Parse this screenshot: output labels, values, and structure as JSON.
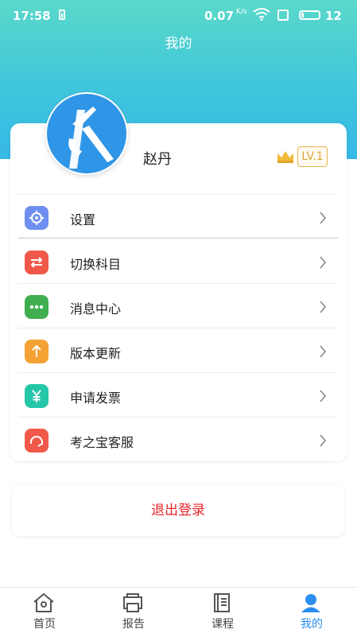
{
  "status_bar": {
    "time": "17:58",
    "speed": "0.07",
    "speed_unit": "K/s",
    "battery": "12"
  },
  "header": {
    "title": "我的"
  },
  "profile": {
    "name": "赵丹",
    "level": "LV.1"
  },
  "menu": {
    "items": [
      {
        "label": "设置",
        "icon": "gear-icon",
        "color": "#6f8ff0"
      },
      {
        "label": "切换科目",
        "icon": "swap-icon",
        "color": "#f0584a"
      },
      {
        "label": "消息中心",
        "icon": "message-icon",
        "color": "#3fae4f"
      },
      {
        "label": "版本更新",
        "icon": "upgrade-icon",
        "color": "#f5a235"
      },
      {
        "label": "申请发票",
        "icon": "invoice-icon",
        "color": "#26c6a8"
      },
      {
        "label": "考之宝客服",
        "icon": "customer-service-icon",
        "color": "#f0584a"
      }
    ]
  },
  "logout": {
    "label": "退出登录"
  },
  "tabbar": {
    "tabs": [
      {
        "label": "首页",
        "icon": "home-icon"
      },
      {
        "label": "报告",
        "icon": "report-icon"
      },
      {
        "label": "课程",
        "icon": "course-icon"
      },
      {
        "label": "我的",
        "icon": "user-icon",
        "active": true
      }
    ]
  },
  "colors": {
    "accent": "#2b8ff0",
    "logout": "#e8262a",
    "level": "#d8a63c"
  }
}
